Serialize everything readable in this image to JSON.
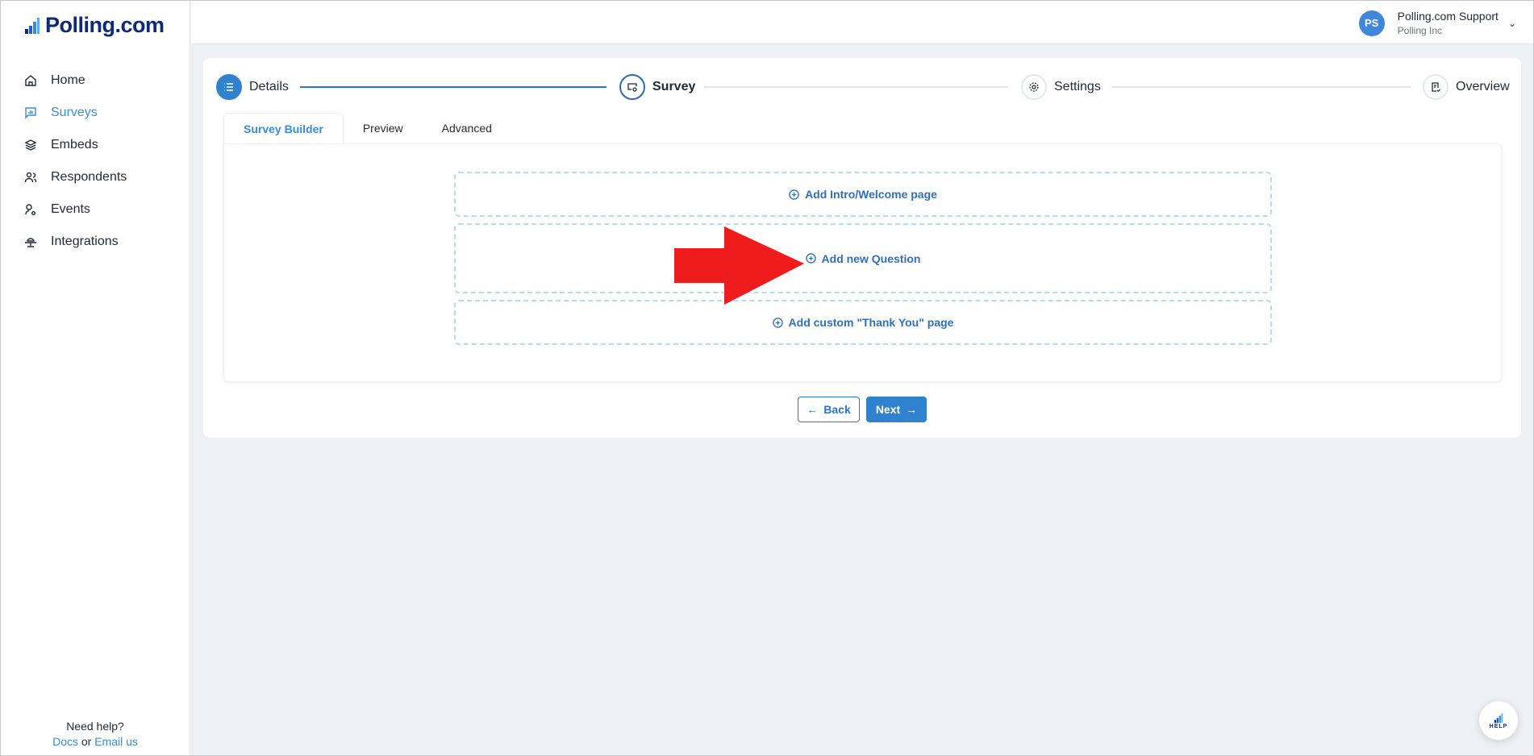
{
  "brand": {
    "name": "Polling.com"
  },
  "sidebar": {
    "items": [
      {
        "label": "Home",
        "icon": "home-icon",
        "active": false
      },
      {
        "label": "Surveys",
        "icon": "survey-chart-icon",
        "active": true
      },
      {
        "label": "Embeds",
        "icon": "layers-icon",
        "active": false
      },
      {
        "label": "Respondents",
        "icon": "users-icon",
        "active": false
      },
      {
        "label": "Events",
        "icon": "user-event-icon",
        "active": false
      },
      {
        "label": "Integrations",
        "icon": "integrations-icon",
        "active": false
      }
    ],
    "help": {
      "title": "Need help?",
      "docs": "Docs",
      "or": "or",
      "email": "Email us"
    }
  },
  "header": {
    "user": {
      "initials": "PS",
      "name": "Polling.com Support",
      "org": "Polling Inc"
    }
  },
  "steps": [
    {
      "label": "Details",
      "state": "done"
    },
    {
      "label": "Survey",
      "state": "current"
    },
    {
      "label": "Settings",
      "state": "pending"
    },
    {
      "label": "Overview",
      "state": "pending"
    }
  ],
  "tabs": [
    {
      "label": "Survey Builder",
      "active": true
    },
    {
      "label": "Preview",
      "active": false
    },
    {
      "label": "Advanced",
      "active": false
    }
  ],
  "builder": {
    "add_intro": "Add Intro/Welcome page",
    "add_question": "Add new Question",
    "add_thankyou": "Add custom \"Thank You\" page"
  },
  "actions": {
    "back": "Back",
    "next": "Next"
  },
  "help_button": {
    "label": "HELP"
  },
  "colors": {
    "accent": "#3182ce",
    "brand": "#0d2a7a",
    "annotation_arrow": "#ee1c1c"
  }
}
